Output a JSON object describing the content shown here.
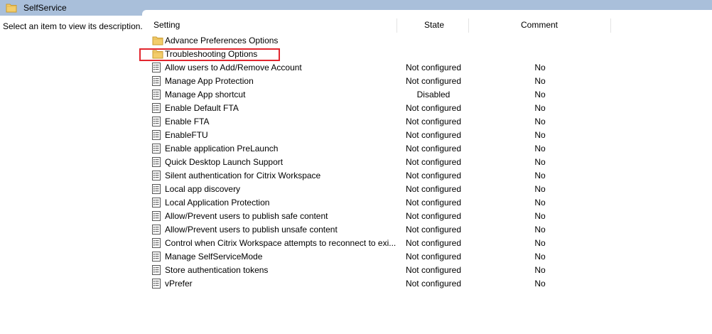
{
  "window": {
    "title": "SelfService",
    "accent_highlight": "#e2262e"
  },
  "left_pane": {
    "description": "Select an item to view its description."
  },
  "columns": {
    "setting": "Setting",
    "state": "State",
    "comment": "Comment"
  },
  "folders": [
    {
      "label": "Advance Preferences Options",
      "icon": "folder-icon"
    },
    {
      "label": "Troubleshooting Options",
      "icon": "folder-icon",
      "highlighted": true
    }
  ],
  "settings": [
    {
      "name": "Allow users to Add/Remove Account",
      "state": "Not configured",
      "comment": "No"
    },
    {
      "name": "Manage App Protection",
      "state": "Not configured",
      "comment": "No"
    },
    {
      "name": "Manage App shortcut",
      "state": "Disabled",
      "comment": "No"
    },
    {
      "name": "Enable Default FTA",
      "state": "Not configured",
      "comment": "No"
    },
    {
      "name": "Enable FTA",
      "state": "Not configured",
      "comment": "No"
    },
    {
      "name": "EnableFTU",
      "state": "Not configured",
      "comment": "No"
    },
    {
      "name": "Enable application PreLaunch",
      "state": "Not configured",
      "comment": "No"
    },
    {
      "name": "Quick Desktop Launch Support",
      "state": "Not configured",
      "comment": "No"
    },
    {
      "name": "Silent authentication for Citrix Workspace",
      "state": "Not configured",
      "comment": "No"
    },
    {
      "name": "Local app discovery",
      "state": "Not configured",
      "comment": "No"
    },
    {
      "name": "Local Application Protection",
      "state": "Not configured",
      "comment": "No"
    },
    {
      "name": "Allow/Prevent users to publish safe content",
      "state": "Not configured",
      "comment": "No"
    },
    {
      "name": "Allow/Prevent users to publish unsafe content",
      "state": "Not configured",
      "comment": "No"
    },
    {
      "name": "Control when Citrix Workspace attempts to reconnect to exi...",
      "state": "Not configured",
      "comment": "No"
    },
    {
      "name": "Manage SelfServiceMode",
      "state": "Not configured",
      "comment": "No"
    },
    {
      "name": "Store authentication tokens",
      "state": "Not configured",
      "comment": "No"
    },
    {
      "name": "vPrefer",
      "state": "Not configured",
      "comment": "No"
    }
  ]
}
